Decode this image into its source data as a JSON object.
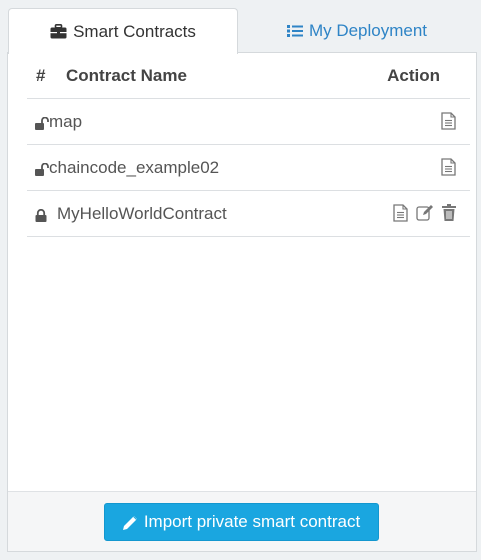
{
  "tabs": [
    {
      "label": "Smart Contracts",
      "icon": "briefcase-icon",
      "active": true
    },
    {
      "label": "My Deployment",
      "icon": "list-icon",
      "active": false
    }
  ],
  "table": {
    "columns": [
      "#",
      "Contract Name",
      "Action"
    ],
    "rows": [
      {
        "name": "map",
        "lock": "unlocked",
        "actions": [
          "document"
        ]
      },
      {
        "name": "chaincode_example02",
        "lock": "unlocked",
        "actions": [
          "document"
        ]
      },
      {
        "name": "MyHelloWorldContract",
        "lock": "locked",
        "actions": [
          "document",
          "edit",
          "delete"
        ]
      }
    ]
  },
  "footer": {
    "import_label": "Import private smart contract"
  },
  "colors": {
    "tab_inactive_text": "#2e84c6",
    "button_bg": "#1aa6e0",
    "icon_gray": "#777777"
  }
}
